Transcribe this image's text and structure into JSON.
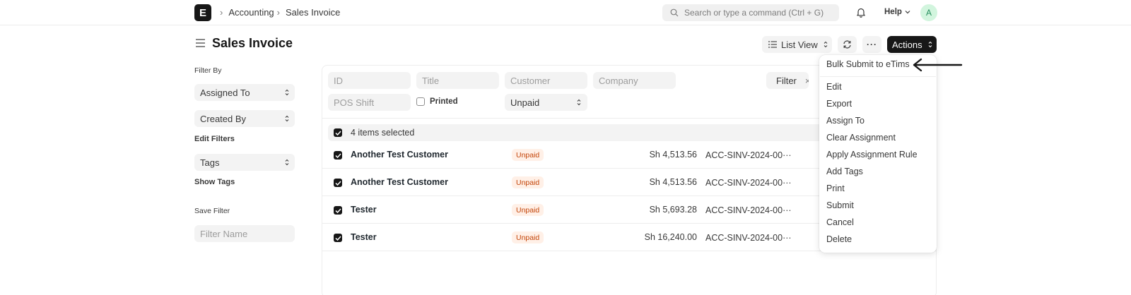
{
  "navbar": {
    "logo_letter": "E",
    "breadcrumbs": [
      "Accounting",
      "Sales Invoice"
    ],
    "search_placeholder": "Search or type a command (Ctrl + G)",
    "help_label": "Help",
    "avatar_letter": "A"
  },
  "page": {
    "title": "Sales Invoice",
    "list_view_label": "List View",
    "actions_label": "Actions"
  },
  "sidebar": {
    "filter_by_label": "Filter By",
    "assigned_to": "Assigned To",
    "created_by": "Created By",
    "edit_filters": "Edit Filters",
    "tags": "Tags",
    "show_tags": "Show Tags",
    "save_filter_label": "Save Filter",
    "filter_name_placeholder": "Filter Name"
  },
  "filters": {
    "id_placeholder": "ID",
    "title_placeholder": "Title",
    "customer_placeholder": "Customer",
    "company_placeholder": "Company",
    "pos_shift_placeholder": "POS Shift",
    "printed_label": "Printed",
    "status_value": "Unpaid",
    "filter_button": "Filter",
    "filter_clear": "×"
  },
  "list": {
    "selected_text": "4 items selected",
    "rows": [
      {
        "title": "Another Test Customer",
        "status": "Unpaid",
        "amount": "Sh 4,513.56",
        "name": "ACC-SINV-2024-00···"
      },
      {
        "title": "Another Test Customer",
        "status": "Unpaid",
        "amount": "Sh 4,513.56",
        "name": "ACC-SINV-2024-00···"
      },
      {
        "title": "Tester",
        "status": "Unpaid",
        "amount": "Sh 5,693.28",
        "name": "ACC-SINV-2024-00···"
      },
      {
        "title": "Tester",
        "status": "Unpaid",
        "amount": "Sh 16,240.00",
        "name": "ACC-SINV-2024-00···"
      }
    ]
  },
  "actions_menu": {
    "items": [
      "Bulk Submit to eTims",
      "Edit",
      "Export",
      "Assign To",
      "Clear Assignment",
      "Apply Assignment Rule",
      "Add Tags",
      "Print",
      "Submit",
      "Cancel",
      "Delete"
    ]
  },
  "colors": {
    "primary_dark": "#171717",
    "badge_bg": "#fff0e7",
    "badge_text": "#c4460b",
    "control_bg": "#f3f3f3"
  }
}
